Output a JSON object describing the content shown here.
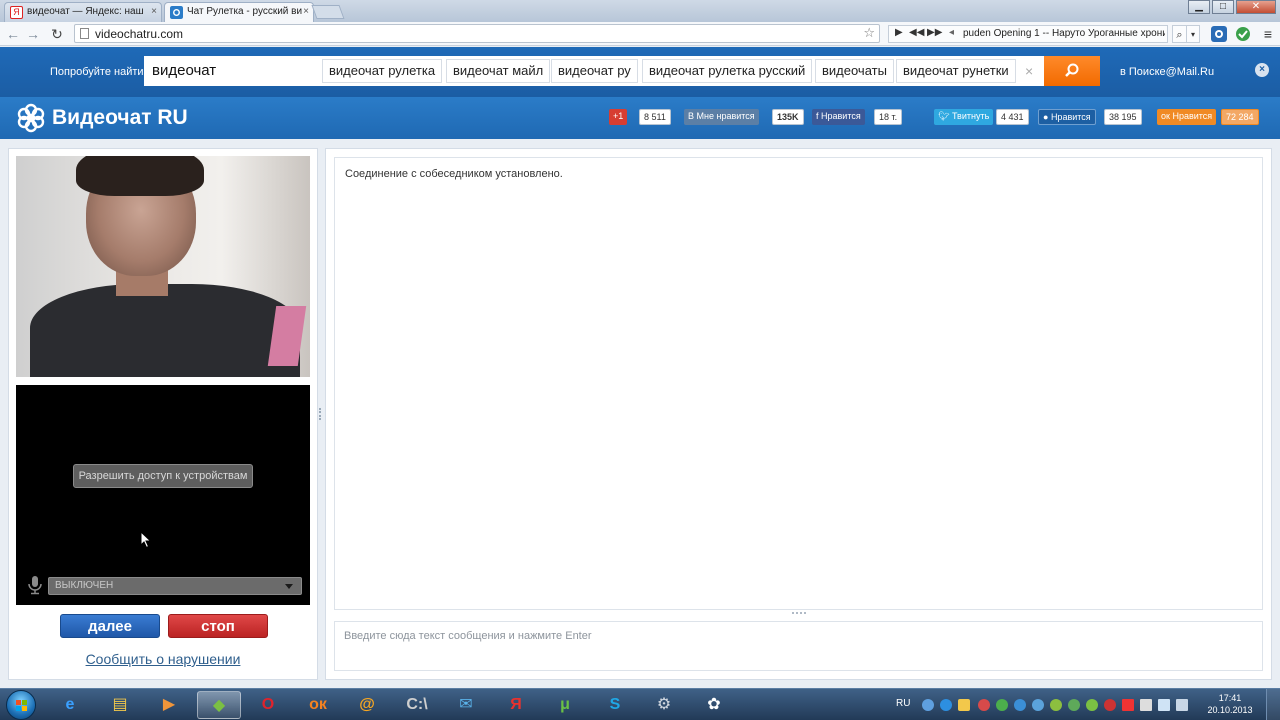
{
  "browser": {
    "tabs": [
      {
        "title": "видеочат — Яндекс: наш",
        "close": "×"
      },
      {
        "title": "Чат Рулетка - русский ви",
        "close": "×"
      }
    ],
    "window_controls": {
      "minimize": "▁",
      "maximize": "□",
      "close": "✕"
    },
    "url": "videochatru.com",
    "star": "☆",
    "media": {
      "controls": [
        "▶",
        "◀◀",
        "▶▶"
      ],
      "track": "puden Opening 1 -- Наруто Урoганные хрони"
    }
  },
  "search_bar": {
    "try_label": "Попробуйте найти",
    "query": "видеочат",
    "suggestions": [
      "видеочат рулетка",
      "видеочат майл",
      "видеочат ру",
      "видеочат рулетка русский",
      "видеочаты",
      "видеочат рунетки"
    ],
    "clear": "×",
    "mailru_link": "в Поиске@Mail.Ru",
    "close": "×"
  },
  "header": {
    "logo_text": "Видеочат RU",
    "social": [
      {
        "label": "+1",
        "count": "8 511",
        "color": "#d73d32"
      },
      {
        "label": "Мне нравится",
        "count": "135K",
        "color": "#5b7fa6"
      },
      {
        "label": "Нравится",
        "count": "18 т.",
        "color": "#3b5998"
      },
      {
        "label": "Твитнуть",
        "count": "4 431",
        "color": "#2fa8e0"
      },
      {
        "label": "Нравится",
        "count": "38 195",
        "color": "#1d5fa3"
      },
      {
        "label": "Нравится",
        "count": "72 284",
        "color": "#f08a24"
      }
    ]
  },
  "video": {
    "allow_access": "Разрешить доступ к устройствам",
    "mic_state": "ВЫКЛЮЧЕН"
  },
  "controls": {
    "next": "далее",
    "stop": "стоп",
    "report": "Сообщить о нарушении"
  },
  "chat": {
    "status_line": "Соединение с собеседником установлено.",
    "input_placeholder": "Введите сюда текст сообщения и нажмите Enter"
  },
  "taskbar": {
    "apps": [
      {
        "name": "internet-explorer",
        "glyph": "e",
        "color": "#3aa0ff"
      },
      {
        "name": "file-explorer",
        "glyph": "▤",
        "color": "#f2c84b"
      },
      {
        "name": "media-player",
        "glyph": "▶",
        "color": "#f0953a"
      },
      {
        "name": "minecraft",
        "glyph": "◆",
        "color": "#7bc043"
      },
      {
        "name": "opera",
        "glyph": "O",
        "color": "#e0232c"
      },
      {
        "name": "odnoklassniki",
        "glyph": "ок",
        "color": "#f58220"
      },
      {
        "name": "mail-agent",
        "glyph": "@",
        "color": "#f5a623"
      },
      {
        "name": "command-prompt",
        "glyph": "C:\\",
        "color": "#cfcfcf"
      },
      {
        "name": "mail",
        "glyph": "✉",
        "color": "#5bb3ea"
      },
      {
        "name": "yandex-browser",
        "glyph": "Я",
        "color": "#e8322e"
      },
      {
        "name": "utorrent",
        "glyph": "μ",
        "color": "#6ac045"
      },
      {
        "name": "skype",
        "glyph": "S",
        "color": "#1fa8e6"
      },
      {
        "name": "system-tools",
        "glyph": "⚙",
        "color": "#cfd6df"
      },
      {
        "name": "videochat-app",
        "glyph": "✿",
        "color": "#ffffff"
      }
    ],
    "lang": "RU",
    "time": "17:41",
    "date": "20.10.2013"
  }
}
